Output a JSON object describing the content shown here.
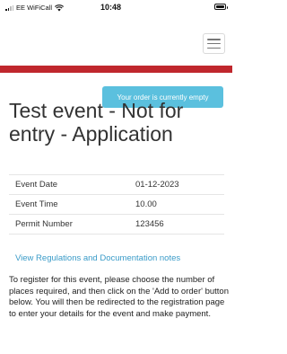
{
  "status_bar": {
    "carrier": "EE WiFiCall",
    "time": "10:48"
  },
  "nav": {
    "menu_icon": "hamburger-menu-icon",
    "accent_color": "#c0272d"
  },
  "cart": {
    "label": "Your order is currently empty",
    "color": "#5bc0de"
  },
  "event": {
    "title": "Test event - Not for entry - Application"
  },
  "details": [
    {
      "label": "Event Date",
      "value": "01-12-2023"
    },
    {
      "label": "Event Time",
      "value": "10.00"
    },
    {
      "label": "Permit Number",
      "value": "123456"
    }
  ],
  "links": {
    "regulations": "View Regulations and Documentation notes"
  },
  "instructions": "To register for this event, please choose the number of places required, and then click on the 'Add to order' button below. You will then be redirected to the registration page to enter your details for the event and make payment."
}
